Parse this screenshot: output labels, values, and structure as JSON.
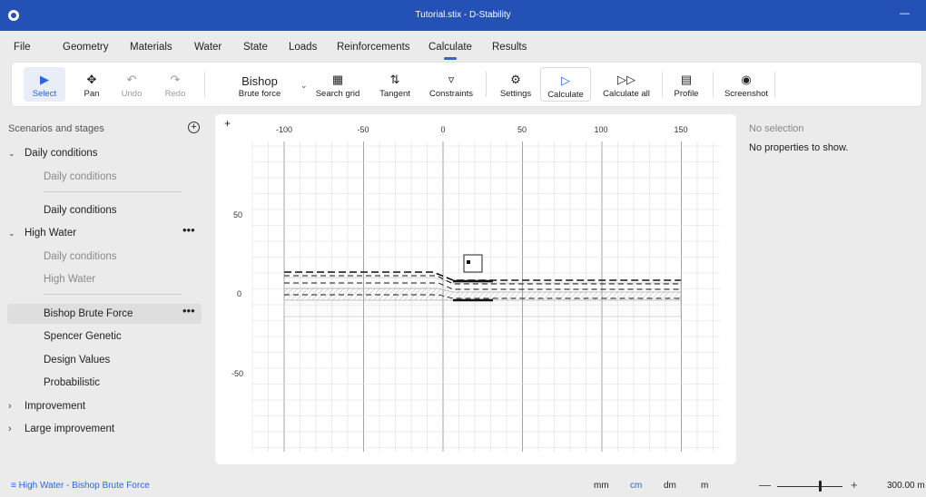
{
  "window": {
    "title": "Tutorial.stix - D-Stability",
    "minimize": "—"
  },
  "menu": [
    "File",
    "Geometry",
    "Materials",
    "Water",
    "State",
    "Loads",
    "Reinforcements",
    "Calculate",
    "Results"
  ],
  "menu_active": "Calculate",
  "ribbon": {
    "select": "Select",
    "pan": "Pan",
    "undo": "Undo",
    "redo": "Redo",
    "method_title": "Bishop",
    "method_sub": "Brute force",
    "search_grid": "Search grid",
    "tangent": "Tangent",
    "constraints": "Constraints",
    "settings": "Settings",
    "calculate": "Calculate",
    "calculate_all": "Calculate all",
    "profile": "Profile",
    "screenshot": "Screenshot"
  },
  "scenarios": {
    "header": "Scenarios and stages",
    "add": "+",
    "items": [
      {
        "label": "Daily conditions",
        "kind": "scenario",
        "expanded": true
      },
      {
        "label": "Daily conditions",
        "kind": "stage",
        "muted": true
      },
      {
        "label": "Daily conditions",
        "kind": "calculation"
      },
      {
        "label": "High Water",
        "kind": "scenario",
        "expanded": true,
        "more": "•••"
      },
      {
        "label": "Daily conditions",
        "kind": "stage",
        "muted": true
      },
      {
        "label": "High Water",
        "kind": "stage",
        "muted": true
      },
      {
        "label": "Bishop Brute Force",
        "kind": "calculation",
        "selected": true,
        "more": "•••"
      },
      {
        "label": "Spencer Genetic",
        "kind": "calculation"
      },
      {
        "label": "Design Values",
        "kind": "calculation"
      },
      {
        "label": "Probabilistic",
        "kind": "calculation"
      },
      {
        "label": "Improvement",
        "kind": "scenario",
        "expanded": false
      },
      {
        "label": "Large improvement",
        "kind": "scenario",
        "expanded": false
      }
    ]
  },
  "canvas": {
    "x_ticks": [
      "-100",
      "-50",
      "0",
      "50",
      "100",
      "150"
    ],
    "y_ticks": [
      "50",
      "0",
      "-50"
    ],
    "corner": "+"
  },
  "properties": {
    "header": "No selection",
    "empty_text": "No properties to show."
  },
  "status": {
    "breadcrumb": "High Water - Bishop Brute Force",
    "units": [
      "mm",
      "cm",
      "dm",
      "m"
    ],
    "active_unit": "cm",
    "zoom_minus": "—",
    "zoom_plus": "+",
    "zoom": "300.00 m",
    "zoom_level": 0.65
  },
  "colors": {
    "accent": "#2d64e5",
    "titlebar": "#2351b5"
  }
}
